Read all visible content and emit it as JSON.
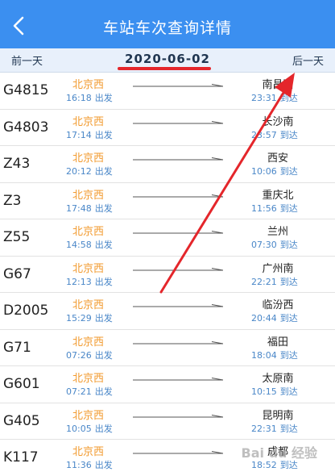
{
  "header": {
    "title": "车站车次查询详情"
  },
  "datebar": {
    "prev_label": "前一天",
    "date": "2020-06-02",
    "next_label": "后一天"
  },
  "labels": {
    "depart": "出发",
    "arrive": "到达"
  },
  "colors": {
    "header_bg": "#3b8ff0",
    "station_from": "#f29a2e",
    "time_blue": "#4a87c8",
    "annotation_red": "#e4262b"
  },
  "trains": [
    {
      "no": "G4815",
      "from": "北京西",
      "dep_time": "16:18",
      "to": "南昌西",
      "arr_time": "23:31"
    },
    {
      "no": "G4803",
      "from": "北京西",
      "dep_time": "17:14",
      "to": "长沙南",
      "arr_time": "23:57"
    },
    {
      "no": "Z43",
      "from": "北京西",
      "dep_time": "20:12",
      "to": "西安",
      "arr_time": "10:06"
    },
    {
      "no": "Z3",
      "from": "北京西",
      "dep_time": "17:48",
      "to": "重庆北",
      "arr_time": "11:56"
    },
    {
      "no": "Z55",
      "from": "北京西",
      "dep_time": "14:58",
      "to": "兰州",
      "arr_time": "07:30"
    },
    {
      "no": "G67",
      "from": "北京西",
      "dep_time": "12:13",
      "to": "广州南",
      "arr_time": "22:21"
    },
    {
      "no": "D2005",
      "from": "北京西",
      "dep_time": "15:29",
      "to": "临汾西",
      "arr_time": "20:44"
    },
    {
      "no": "G71",
      "from": "北京西",
      "dep_time": "07:26",
      "to": "福田",
      "arr_time": "18:04"
    },
    {
      "no": "G601",
      "from": "北京西",
      "dep_time": "07:21",
      "to": "太原南",
      "arr_time": "10:15"
    },
    {
      "no": "G405",
      "from": "北京西",
      "dep_time": "10:05",
      "to": "昆明南",
      "arr_time": "22:31"
    },
    {
      "no": "K117",
      "from": "北京西",
      "dep_time": "11:36",
      "to": "成都",
      "arr_time": "18:52"
    }
  ],
  "watermark": "Bai du 经验"
}
